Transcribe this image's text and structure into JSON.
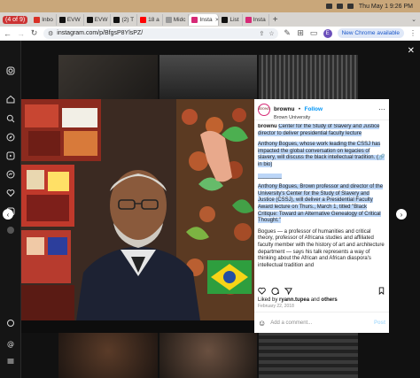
{
  "mac": {
    "menu_left": "☰",
    "clock": "Thu May 1  9:26 PM"
  },
  "tabs": {
    "count_badge": "(4 of 9)",
    "items": [
      {
        "label": "Inbo",
        "color": "#d93025"
      },
      {
        "label": "EVW",
        "color": "#111111"
      },
      {
        "label": "EVW",
        "color": "#111111"
      },
      {
        "label": "(2) T",
        "color": "#111111"
      },
      {
        "label": "18 a",
        "color": "#ff0000"
      },
      {
        "label": "Midc",
        "color": "#999999"
      },
      {
        "label": "Insta",
        "color": "#d62976",
        "active": true
      },
      {
        "label": "List",
        "color": "#111111"
      },
      {
        "label": "Insta",
        "color": "#d62976"
      }
    ]
  },
  "toolbar": {
    "url": "instagram.com/p/BfgsP8YlsPZ/",
    "profile_initial": "E",
    "chrome_pill": "New Chrome available"
  },
  "post": {
    "account": "brownu",
    "follow": "Follow",
    "subtitle": "Brown University",
    "avatar_text": "Brown",
    "caption": {
      "handle": "brownu",
      "p1": "Center for the Study of Slavery and Justice director to deliver presidential faculty lecture",
      "p2": "Anthony Bogues, whose work leading the CSSJ has impacted the global conversation on legacies of slavery, will discuss the black intellectual tradition. (🔗 in bio)",
      "divider": "________",
      "p3": "Anthony Bogues, Brown professor and director of the University's Center for the Study of Slavery and Justice (CSSJ), will deliver a Presidential Faculty Award lecture on Thurs., March 1, titled \"Black Critique: Toward an Alternative Genealogy of Critical Thought.\"",
      "p4": "Bogues — a professor of humanities and critical theory, professor of Africana studies and affiliated faculty member with the history of art and architecture department — says his talk represents a way of thinking about the African and African diaspora's intellectual tradition and"
    },
    "liked_prefix": "Liked by",
    "liked_user": "ryann.tupea",
    "liked_suffix": "and",
    "liked_others": "others",
    "date": "February 22, 2018",
    "comment_placeholder": "Add a comment...",
    "post_label": "Post"
  }
}
